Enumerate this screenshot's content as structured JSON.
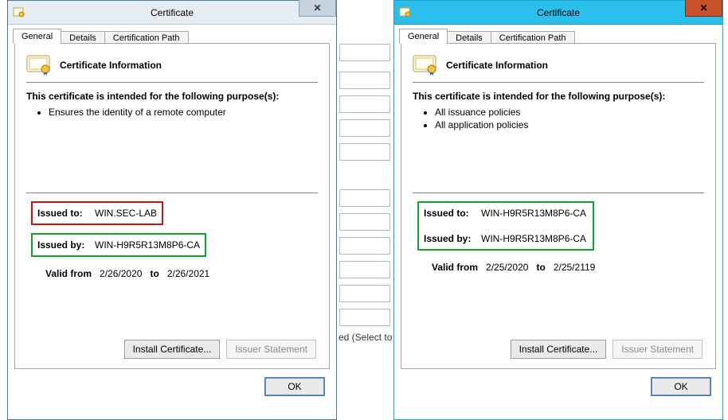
{
  "left": {
    "title": "Certificate",
    "tabs": {
      "general": "General",
      "details": "Details",
      "path": "Certification Path"
    },
    "heading": "Certificate Information",
    "purposeLine": "This certificate is intended for the following purpose(s):",
    "purposes": [
      "Ensures the identity of a remote computer"
    ],
    "issuedToLabel": "Issued to:",
    "issuedTo": "WIN.SEC-LAB",
    "issuedByLabel": "Issued by:",
    "issuedBy": "WIN-H9R5R13M8P6-CA",
    "validFromLabel": "Valid from",
    "validFrom": "2/26/2020",
    "validToLabel": "to",
    "validTo": "2/26/2021",
    "installBtn": "Install Certificate...",
    "issuerBtn": "Issuer Statement",
    "ok": "OK"
  },
  "right": {
    "title": "Certificate",
    "tabs": {
      "general": "General",
      "details": "Details",
      "path": "Certification Path"
    },
    "heading": "Certificate Information",
    "purposeLine": "This certificate is intended for the following purpose(s):",
    "purposes": [
      "All issuance policies",
      "All application policies"
    ],
    "issuedToLabel": "Issued to:",
    "issuedTo": "WIN-H9R5R13M8P6-CA",
    "issuedByLabel": "Issued by:",
    "issuedBy": "WIN-H9R5R13M8P6-CA",
    "validFromLabel": "Valid from",
    "validFrom": "2/25/2020",
    "validToLabel": "to",
    "validTo": "2/25/2119",
    "installBtn": "Install Certificate...",
    "issuerBtn": "Issuer Statement",
    "ok": "OK"
  },
  "background": {
    "textFragment": "ed (Select to c"
  }
}
